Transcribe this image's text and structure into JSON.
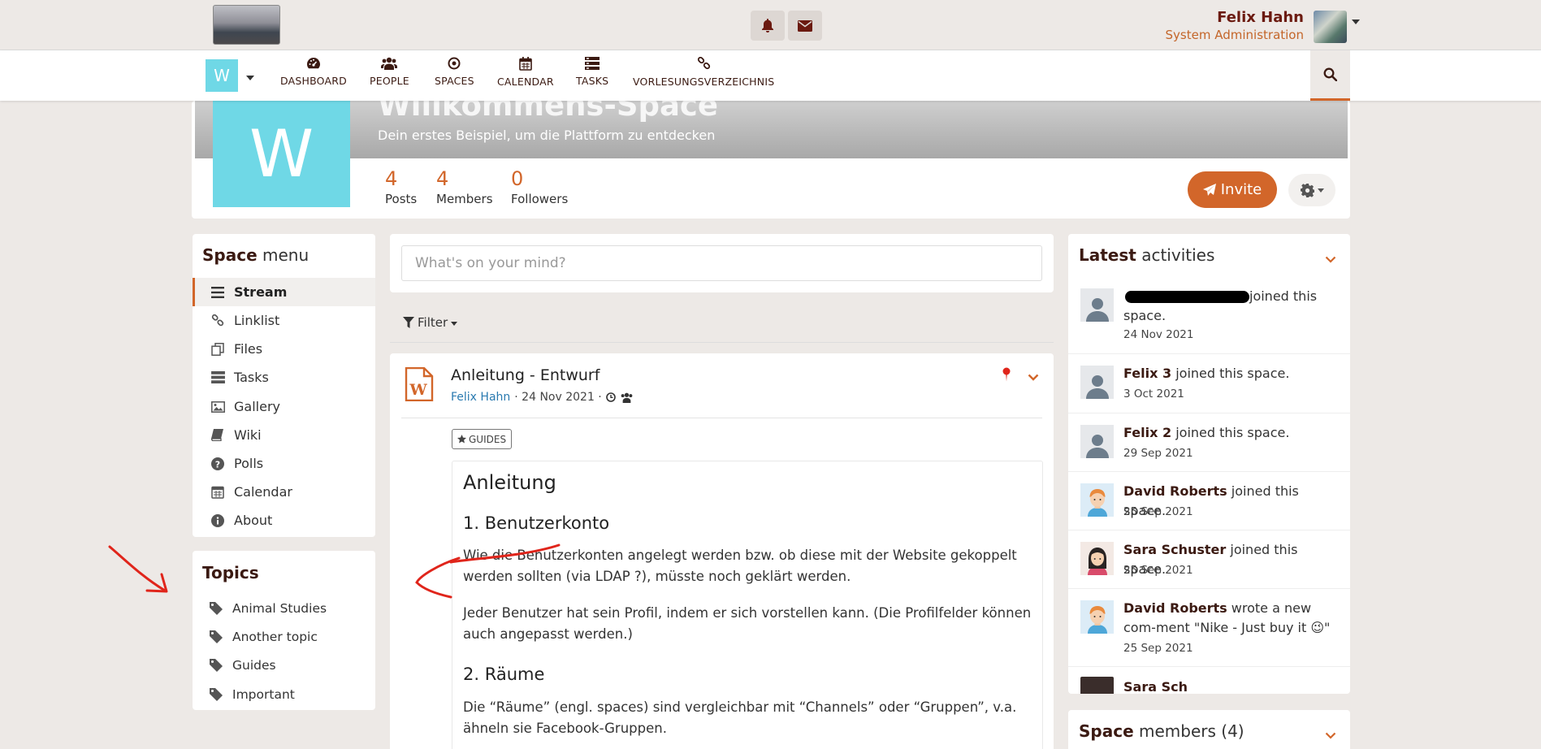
{
  "topbar": {
    "user_name": "Felix Hahn",
    "user_role": "System Administration"
  },
  "nav": {
    "space_initial": "W",
    "items": [
      {
        "label": "DASHBOARD",
        "icon": "dashboard-icon"
      },
      {
        "label": "PEOPLE",
        "icon": "people-icon"
      },
      {
        "label": "SPACES",
        "icon": "spaces-icon"
      },
      {
        "label": "CALENDAR",
        "icon": "calendar-icon"
      },
      {
        "label": "TASKS",
        "icon": "tasks-icon"
      },
      {
        "label": "VORLESUNGSVERZEICHNIS",
        "icon": "link-icon"
      }
    ]
  },
  "space": {
    "title": "Willkommens-Space",
    "description": "Dein erstes Beispiel, um die Plattform zu entdecken",
    "initial": "W",
    "stats": [
      {
        "count": "4",
        "label": "Posts"
      },
      {
        "count": "4",
        "label": "Members"
      },
      {
        "count": "0",
        "label": "Followers"
      }
    ],
    "invite_label": "Invite"
  },
  "space_menu": {
    "title_bold": "Space",
    "title_rest": " menu",
    "items": [
      {
        "label": "Stream",
        "icon": "list-icon"
      },
      {
        "label": "Linklist",
        "icon": "link-icon"
      },
      {
        "label": "Files",
        "icon": "files-icon"
      },
      {
        "label": "Tasks",
        "icon": "tasks-icon"
      },
      {
        "label": "Gallery",
        "icon": "gallery-icon"
      },
      {
        "label": "Wiki",
        "icon": "book-icon"
      },
      {
        "label": "Polls",
        "icon": "question-icon"
      },
      {
        "label": "Calendar",
        "icon": "calendar-icon"
      },
      {
        "label": "About",
        "icon": "info-icon"
      }
    ]
  },
  "topics": {
    "title": "Topics",
    "items": [
      "Animal Studies",
      "Another topic",
      "Guides",
      "Important"
    ]
  },
  "composer": {
    "placeholder": "What's on your mind?"
  },
  "filter_label": "Filter",
  "post": {
    "title": "Anleitung - Entwurf",
    "author": "Felix Hahn",
    "date": "· 24 Nov 2021 ·",
    "badge": "GUIDES",
    "heading": "Anleitung",
    "section1": "1. Benutzerkonto",
    "para1": "Wie die Benutzerkonten angelegt werden bzw. ob diese mit der Website gekoppelt werden sollten (via LDAP ?), müsste noch geklärt werden.",
    "para2": "Jeder Benutzer hat sein Profil, indem er sich vorstellen kann. (Die Profilfelder können auch angepasst werden.)",
    "section2": "2. Räume",
    "para3": "Die “Räume” (engl. spaces) sind vergleichbar mit “Channels” oder “Gruppen”, v.a. ähneln sie Facebook-Gruppen."
  },
  "activities": {
    "title_bold": "Latest",
    "title_rest": " activities",
    "items": [
      {
        "name": "",
        "text": "joined this space.",
        "date": "24 Nov 2021"
      },
      {
        "name": "Felix 3",
        "text": " joined this space.",
        "date": "3 Oct 2021"
      },
      {
        "name": "Felix 2",
        "text": " joined this space.",
        "date": "29 Sep 2021"
      },
      {
        "name": "David Roberts",
        "text": " joined this space.",
        "date": "25 Sep 2021"
      },
      {
        "name": "Sara Schuster",
        "text": " joined this space.",
        "date": "25 Sep 2021"
      },
      {
        "name": "David Roberts",
        "text": " wrote a new com-ment \"Nike - Just buy it 😉\"",
        "date": "25 Sep 2021"
      },
      {
        "name": "Sara Sch",
        "text": "",
        "date": ""
      }
    ]
  },
  "members": {
    "title_bold": "Space",
    "title_rest": " members (4)"
  },
  "colors": {
    "accent": "#d2662a",
    "brand_dark": "#3b1a12",
    "space_color": "#6fd8e6",
    "annotation_red": "#e0251b"
  }
}
